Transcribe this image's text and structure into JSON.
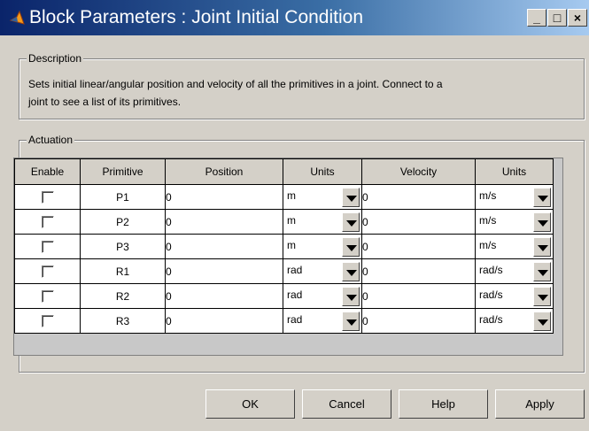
{
  "window": {
    "title": "Block Parameters : Joint Initial Condition",
    "controls": [
      "_",
      "□",
      "×"
    ]
  },
  "description": {
    "legend": "Description",
    "text_line1": "Sets initial linear/angular position and velocity of all the primitives in a joint. Connect to a",
    "text_line2": "joint to see a list of its primitives."
  },
  "actuation": {
    "legend": "Actuation",
    "headers": {
      "enable": "Enable",
      "primitive": "Primitive",
      "position": "Position",
      "units": "Units",
      "velocity": "Velocity",
      "vunits": "Units"
    },
    "rows": [
      {
        "enabled": false,
        "primitive": "P1",
        "position": "0",
        "units": "m",
        "velocity": "0",
        "vunits": "m/s"
      },
      {
        "enabled": false,
        "primitive": "P2",
        "position": "0",
        "units": "m",
        "velocity": "0",
        "vunits": "m/s"
      },
      {
        "enabled": false,
        "primitive": "P3",
        "position": "0",
        "units": "m",
        "velocity": "0",
        "vunits": "m/s"
      },
      {
        "enabled": false,
        "primitive": "R1",
        "position": "0",
        "units": "rad",
        "velocity": "0",
        "vunits": "rad/s"
      },
      {
        "enabled": false,
        "primitive": "R2",
        "position": "0",
        "units": "rad",
        "velocity": "0",
        "vunits": "rad/s"
      },
      {
        "enabled": false,
        "primitive": "R3",
        "position": "0",
        "units": "rad",
        "velocity": "0",
        "vunits": "rad/s"
      }
    ]
  },
  "buttons": {
    "ok": "OK",
    "cancel": "Cancel",
    "help": "Help",
    "apply": "Apply"
  },
  "colors": {
    "titlebar_start": "#0a246a",
    "titlebar_end": "#a6caf0",
    "dialog_bg": "#d4d0c8",
    "icon_orange": "#f59a1a"
  }
}
